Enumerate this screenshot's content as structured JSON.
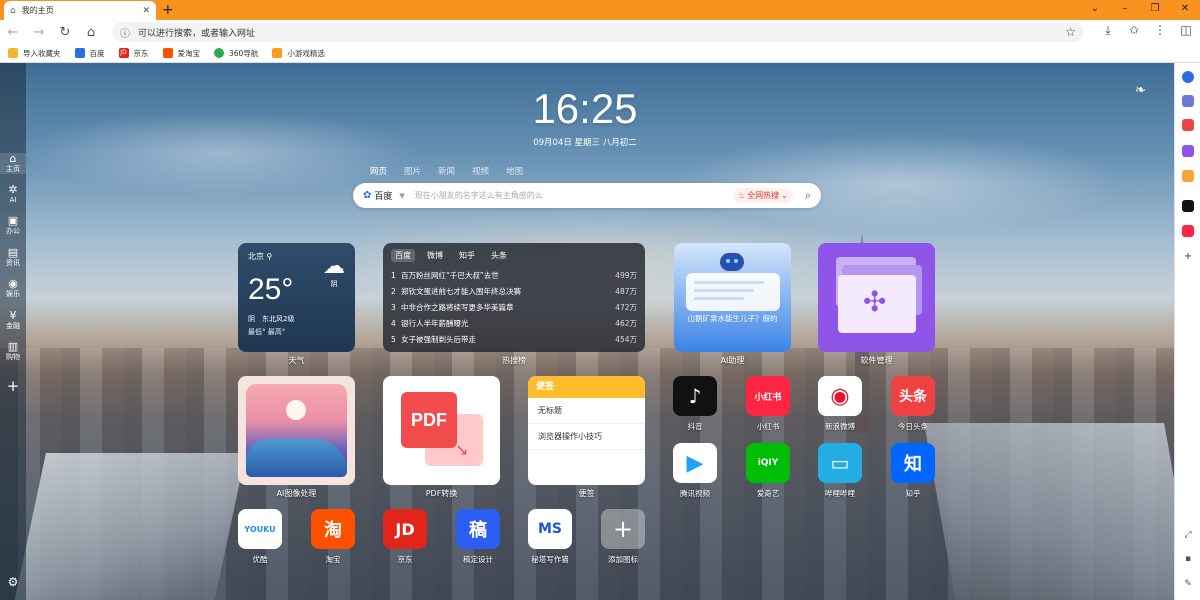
{
  "tab": {
    "title": "我的主页",
    "close": "✕",
    "new": "+"
  },
  "window": {
    "menu": "⌄",
    "minimize": "–",
    "restore": "❐",
    "close": "✕"
  },
  "toolbar": {
    "address_placeholder": "可以进行搜索，或者输入网址"
  },
  "bookmarks": [
    {
      "label": "导入收藏夹",
      "color": "#f2b630"
    },
    {
      "label": "百度",
      "color": "#2b6de4"
    },
    {
      "label": "京东",
      "color": "#e1251b"
    },
    {
      "label": "爱淘宝",
      "color": "#ff5000"
    },
    {
      "label": "360导航",
      "color": "#2ea84a"
    },
    {
      "label": "小游戏精选",
      "color": "#f59a23"
    }
  ],
  "sidebar": [
    {
      "icon": "⌂",
      "label": "主页"
    },
    {
      "icon": "✲",
      "label": "AI"
    },
    {
      "icon": "▣",
      "label": "办公"
    },
    {
      "icon": "▤",
      "label": "资讯"
    },
    {
      "icon": "◉",
      "label": "娱乐"
    },
    {
      "icon": "¥",
      "label": "金融"
    },
    {
      "icon": "▥",
      "label": "购物"
    }
  ],
  "clock": {
    "time": "16:25",
    "date": "09月04日 星期三 八月初二"
  },
  "search": {
    "tabs": [
      "网页",
      "图片",
      "新闻",
      "视频",
      "地图"
    ],
    "engine": "百度",
    "placeholder": "现在小朋友的名字这么有主角感的么",
    "hot_label": "全网热搜"
  },
  "weather": {
    "city": "北京",
    "temp": "25°",
    "cond": "阴",
    "wind": "阴　东北风2级",
    "range": "最低° 最高°",
    "caption": "天气"
  },
  "hot": {
    "tabs": [
      "百度",
      "微博",
      "知乎",
      "头条"
    ],
    "items": [
      {
        "n": "1",
        "t": "百万粉丝网红“千巴大叔”去世",
        "v": "499万"
      },
      {
        "n": "2",
        "t": "郑钦文蛋进前七才能入围年终总决赛",
        "v": "487万"
      },
      {
        "n": "3",
        "t": "中非合作之路将续写更多华美篇章",
        "v": "472万"
      },
      {
        "n": "4",
        "t": "银行人半年薪酬曝光",
        "v": "462万"
      },
      {
        "n": "5",
        "t": "女子被强制剃头后带走",
        "v": "454万"
      }
    ],
    "caption": "热搜榜"
  },
  "ai": {
    "question": "山鹅矿泉水能生儿子？假的",
    "caption": "AI助理"
  },
  "soft": {
    "caption": "软件管理"
  },
  "aiimg": {
    "caption": "AI图像处理"
  },
  "pdf": {
    "label": "PDF",
    "caption": "PDF转换"
  },
  "note": {
    "title": "便签",
    "items": [
      "无标题",
      "浏览器操作小技巧"
    ],
    "caption": "便签"
  },
  "apps_right": [
    {
      "label": "抖音",
      "glyph": "♪",
      "bg": "#111111",
      "fg": "#ffffff"
    },
    {
      "label": "小红书",
      "glyph": "小红书",
      "bg": "#ff2442",
      "fg": "#ffffff"
    },
    {
      "label": "新浪微博",
      "glyph": "◉",
      "bg": "#ffffff",
      "fg": "#e6162d"
    },
    {
      "label": "今日头条",
      "glyph": "头条",
      "bg": "#f04142",
      "fg": "#ffffff"
    },
    {
      "label": "腾讯视频",
      "glyph": "▶",
      "bg": "#ffffff",
      "fg": "#20a0ff"
    },
    {
      "label": "爱奇艺",
      "glyph": "iQIY",
      "bg": "#00be06",
      "fg": "#ffffff"
    },
    {
      "label": "哔哩哔哩",
      "glyph": "▭",
      "bg": "#23ade5",
      "fg": "#ffffff"
    },
    {
      "label": "知乎",
      "glyph": "知",
      "bg": "#0066ff",
      "fg": "#ffffff"
    }
  ],
  "apps_bottom": [
    {
      "label": "优酷",
      "glyph": "YOUKU",
      "bg": "#ffffff",
      "fg": "#1f8df5"
    },
    {
      "label": "淘宝",
      "glyph": "淘",
      "bg": "#ff5000",
      "fg": "#ffffff"
    },
    {
      "label": "京东",
      "glyph": "JD",
      "bg": "#e1251b",
      "fg": "#ffffff"
    },
    {
      "label": "稿定设计",
      "glyph": "稿",
      "bg": "#2c5ef2",
      "fg": "#ffffff"
    },
    {
      "label": "秘塔写作猫",
      "glyph": "MS",
      "bg": "#ffffff",
      "fg": "#1a57d6"
    },
    {
      "label": "添加图标",
      "glyph": "+",
      "bg": "rgba(255,255,255,0.35)",
      "fg": "#ffffff"
    }
  ]
}
